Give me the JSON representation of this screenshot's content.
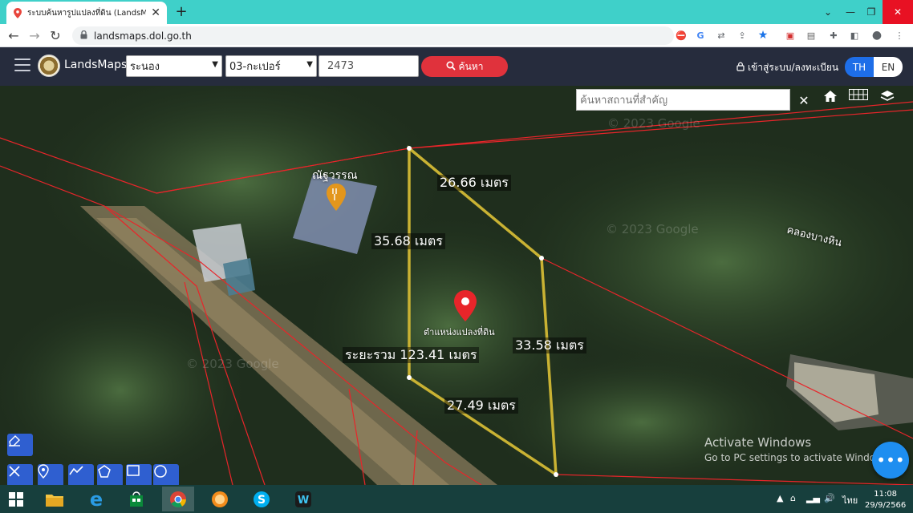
{
  "browser": {
    "tab_title": "ระบบค้นหารูปแปลงที่ดิน (LandsMaps",
    "url": "landsmaps.dol.go.th"
  },
  "header": {
    "brand": "LandsMaps",
    "province": "ระนอง",
    "district": "03-กะเปอร์",
    "parcel_number": "2473",
    "search_label": "ค้นหา",
    "login_label": "เข้าสู่ระบบ/ลงทะเบียน",
    "lang_th": "TH",
    "lang_en": "EN",
    "accent_red": "#e0323c",
    "accent_blue": "#1e6ee8"
  },
  "map": {
    "place_search_placeholder": "ค้นหาสถานที่สำคัญ",
    "close_label": "✕",
    "measurements": {
      "side_top": "26.66 เมตร",
      "side_left": "35.68 เมตร",
      "side_right": "33.58 เมตร",
      "side_bottom": "27.49 เมตร",
      "total": "ระยะรวม 123.41 เมตร"
    },
    "pin_label": "ตำแหน่งแปลงที่ดิน",
    "poi_label": "ณัฐวรรณ",
    "canal_label": "คลองบางหิน",
    "watermark": "© 2023 Google",
    "parcel_line_color": "#c9b233",
    "boundary_color": "#e8252a"
  },
  "overlay": {
    "activate_title": "Activate Windows",
    "activate_sub": "Go to PC settings to activate Windows.",
    "fab_label": "•••"
  },
  "taskbar": {
    "lang": "ไทย",
    "time": "11:08",
    "date": "29/9/2566"
  }
}
